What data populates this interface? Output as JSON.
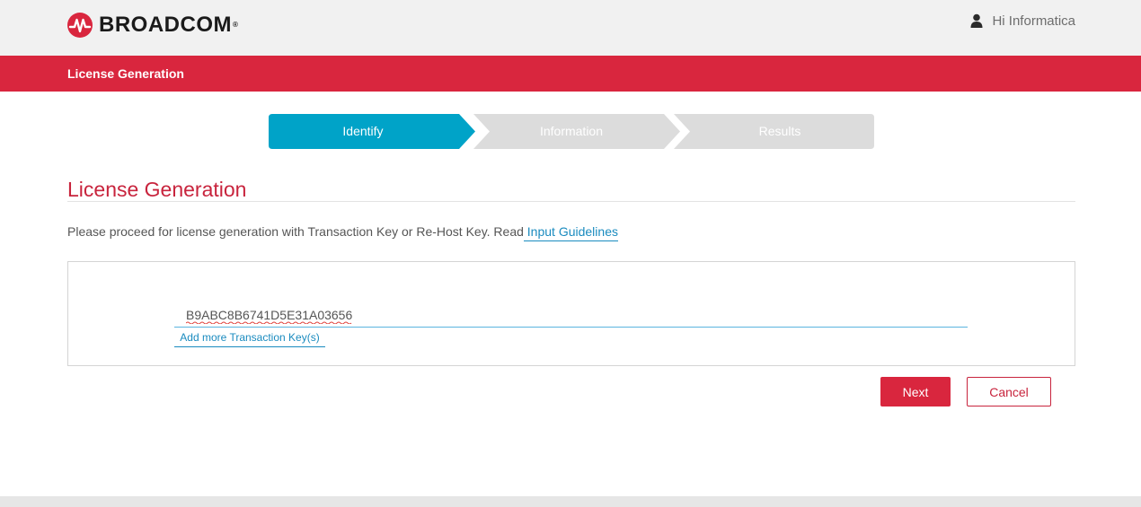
{
  "header": {
    "brand": "BROADCOM",
    "brand_reg": "®",
    "greeting": "Hi Informatica",
    "logo_color": "#d9263e"
  },
  "banner": {
    "title": "License Generation",
    "color": "#d9263e"
  },
  "stepper": {
    "steps": [
      {
        "label": "Identify",
        "state": "active"
      },
      {
        "label": "Information",
        "state": "inactive"
      },
      {
        "label": "Results",
        "state": "inactive"
      }
    ],
    "active_color": "#00a3c8",
    "inactive_color": "#dcdcdc"
  },
  "main": {
    "title": "License Generation",
    "intro_text": "Please proceed for license generation with Transaction Key or Re-Host Key. Read",
    "intro_link": " Input Guidelines",
    "transaction_key_value": "B9ABC8B6741D5E31A03656",
    "add_more_label": "Add more Transaction Key(s)"
  },
  "actions": {
    "next_label": "Next",
    "cancel_label": "Cancel"
  }
}
